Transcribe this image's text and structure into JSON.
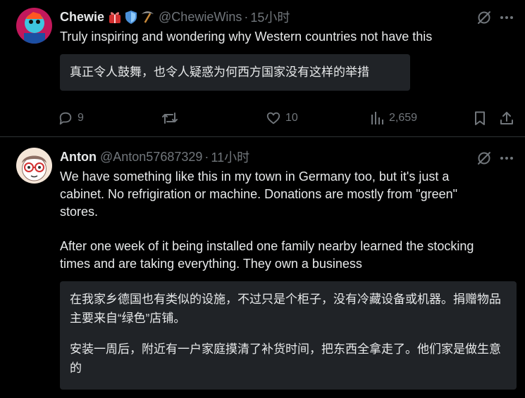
{
  "tweet1": {
    "display_name": "Chewie",
    "badge_icons": [
      "gift-icon",
      "shield-icon",
      "pickaxe-icon"
    ],
    "handle": "@ChewieWins",
    "separator": "·",
    "time": "15小时",
    "text": "Truly inspiring and wondering why Western countries not have this",
    "translation": "真正令人鼓舞，也令人疑惑为何西方国家没有这样的举措",
    "replies": "9",
    "retweets": "",
    "likes": "10",
    "views": "2,659"
  },
  "tweet2": {
    "display_name": "Anton",
    "handle": "@Anton57687329",
    "separator": "·",
    "time": "11小时",
    "text_p1": "We have something like this in my town in Germany too, but it's just a cabinet. No refrigiration or machine. Donations are mostly from \"green\" stores.",
    "text_p2": "After one week of it being installed one family nearby learned the stocking times and are taking everything. They own a business",
    "translation_p1": "在我家乡德国也有类似的设施，不过只是个柜子，没有冷藏设备或机器。捐赠物品主要来自“绿色”店铺。",
    "translation_p2": "安装一周后，附近有一户家庭摸清了补货时间，把东西全拿走了。他们家是做生意的"
  },
  "icons": {
    "grok": "grok-icon",
    "more": "more-icon",
    "reply": "reply-icon",
    "retweet": "retweet-icon",
    "like": "like-icon",
    "views": "views-icon",
    "bookmark": "bookmark-icon",
    "share": "share-icon"
  },
  "colors": {
    "background": "#000000",
    "text_primary": "#e7e9ea",
    "text_secondary": "#71767b",
    "translation_box": "#202327",
    "divider": "#2f3336"
  }
}
